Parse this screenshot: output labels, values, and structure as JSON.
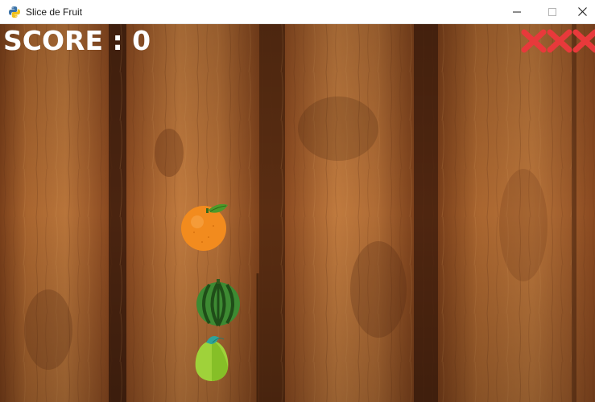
{
  "window": {
    "title": "Slice de Fruit",
    "app_icon": "python-icon",
    "controls": [
      "minimize-icon",
      "maximize-icon",
      "close-icon"
    ]
  },
  "hud": {
    "score_text": "SCORE : 0",
    "lives_lost": 3,
    "lives_total": 3,
    "life_icon": "red-x-icon"
  },
  "fruits": [
    {
      "kind": "orange",
      "icon": "orange-icon"
    },
    {
      "kind": "watermelon",
      "icon": "watermelon-icon"
    },
    {
      "kind": "guava",
      "icon": "guava-icon"
    }
  ],
  "colors": {
    "wood_base": "#9c5a2c",
    "wood_dark": "#5e2f13",
    "wood_light": "#c07a3e",
    "life_x": "#e8393b",
    "score_text": "#ffffff",
    "orange": "#f28b1e",
    "watermelon": "#3d8a32",
    "guava": "#9fd23a"
  }
}
